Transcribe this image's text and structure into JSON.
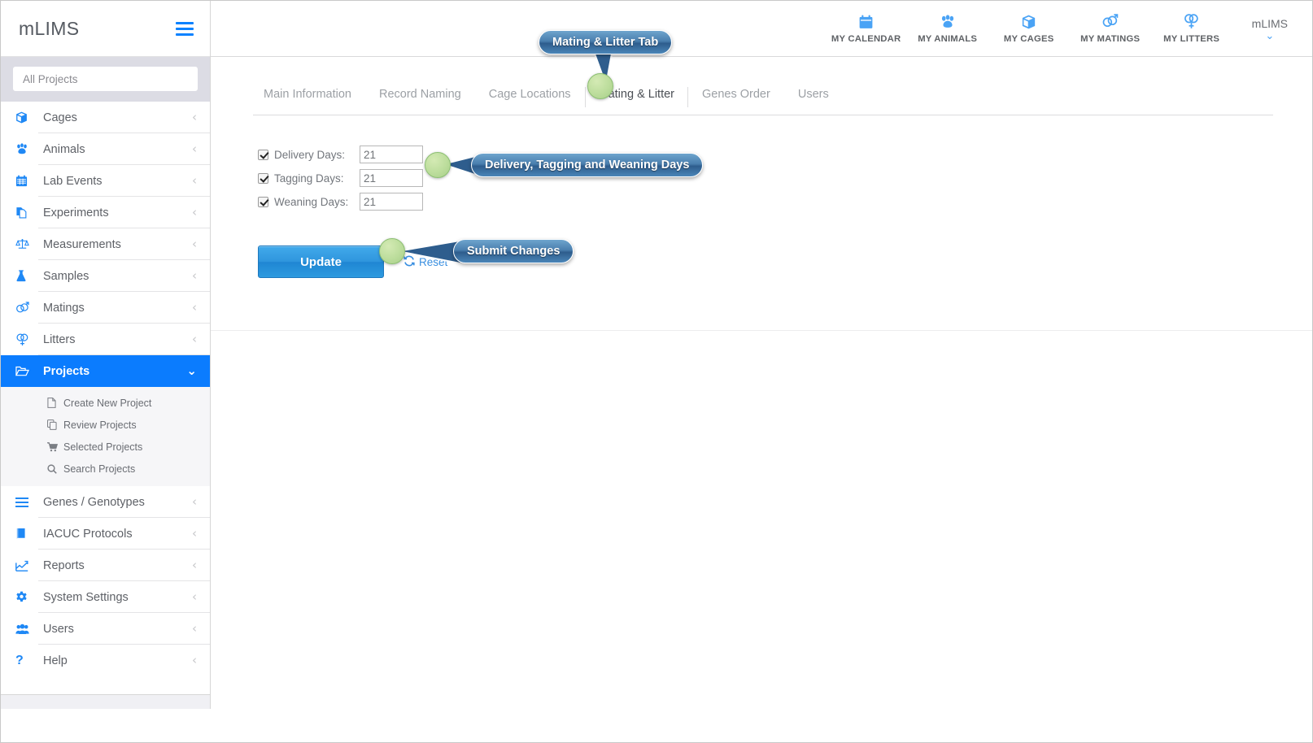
{
  "brand": {
    "name": "mLIMS",
    "menu_icon": "hamburger-icon"
  },
  "sidebar": {
    "search": {
      "placeholder": "All Projects",
      "value": ""
    },
    "items": [
      {
        "label": "Cages",
        "icon": "cube-icon",
        "chevron": "‹"
      },
      {
        "label": "Animals",
        "icon": "paw-icon",
        "chevron": "‹"
      },
      {
        "label": "Lab Events",
        "icon": "calendar-icon",
        "chevron": "‹"
      },
      {
        "label": "Experiments",
        "icon": "document-icon",
        "chevron": "‹"
      },
      {
        "label": "Measurements",
        "icon": "scale-icon",
        "chevron": "‹"
      },
      {
        "label": "Samples",
        "icon": "flask-icon",
        "chevron": "‹"
      },
      {
        "label": "Matings",
        "icon": "mating-icon",
        "chevron": "‹"
      },
      {
        "label": "Litters",
        "icon": "litter-icon",
        "chevron": "‹"
      },
      {
        "label": "Projects",
        "icon": "folder-icon",
        "chevron": "⌄",
        "active": true
      },
      {
        "label": "Genes / Genotypes",
        "icon": "list-icon",
        "chevron": "‹"
      },
      {
        "label": "IACUC Protocols",
        "icon": "book-icon",
        "chevron": "‹"
      },
      {
        "label": "Reports",
        "icon": "chart-icon",
        "chevron": "‹"
      },
      {
        "label": "System Settings",
        "icon": "gear-icon",
        "chevron": "‹"
      },
      {
        "label": "Users",
        "icon": "users-icon",
        "chevron": "‹"
      },
      {
        "label": "Help",
        "icon": "question-icon",
        "chevron": "‹"
      }
    ],
    "projects_subitems": [
      {
        "label": "Create New Project",
        "icon": "file-icon"
      },
      {
        "label": "Review Projects",
        "icon": "copy-icon"
      },
      {
        "label": "Selected Projects",
        "icon": "cart-icon"
      },
      {
        "label": "Search Projects",
        "icon": "search-icon"
      }
    ]
  },
  "topbar": {
    "links": [
      {
        "label": "MY CALENDAR",
        "icon": "calendar-icon"
      },
      {
        "label": "MY ANIMALS",
        "icon": "paw-icon"
      },
      {
        "label": "MY CAGES",
        "icon": "cube-icon"
      },
      {
        "label": "MY MATINGS",
        "icon": "mating-icon"
      },
      {
        "label": "MY LITTERS",
        "icon": "litter-icon"
      }
    ],
    "user": {
      "name": "mLIMS",
      "caret": "⌄"
    }
  },
  "main": {
    "tabs": [
      {
        "label": "Main Information",
        "active": false
      },
      {
        "label": "Record Naming",
        "active": false
      },
      {
        "label": "Cage Locations",
        "active": false
      },
      {
        "label": "Mating & Litter",
        "active": true
      },
      {
        "label": "Genes Order",
        "active": false
      },
      {
        "label": "Users",
        "active": false
      }
    ],
    "form": {
      "rows": [
        {
          "label": "Delivery Days:",
          "value": "21",
          "checked": true
        },
        {
          "label": "Tagging Days:",
          "value": "21",
          "checked": true
        },
        {
          "label": "Weaning Days:",
          "value": "21",
          "checked": true
        }
      ]
    },
    "actions": {
      "update_label": "Update",
      "reset_label": "Reset",
      "reset_icon": "refresh-icon"
    }
  },
  "callouts": [
    {
      "text": "Mating & Litter Tab"
    },
    {
      "text": "Delivery, Tagging and Weaning Days"
    },
    {
      "text": "Submit Changes"
    }
  ],
  "colors": {
    "accent_blue": "#0b7cfe",
    "icon_blue": "#1f88f5",
    "callout_blue": "#2e5d8d",
    "callout_dot_green": "#bcdd9c",
    "sidebar_search_bg": "#dcdce4"
  }
}
